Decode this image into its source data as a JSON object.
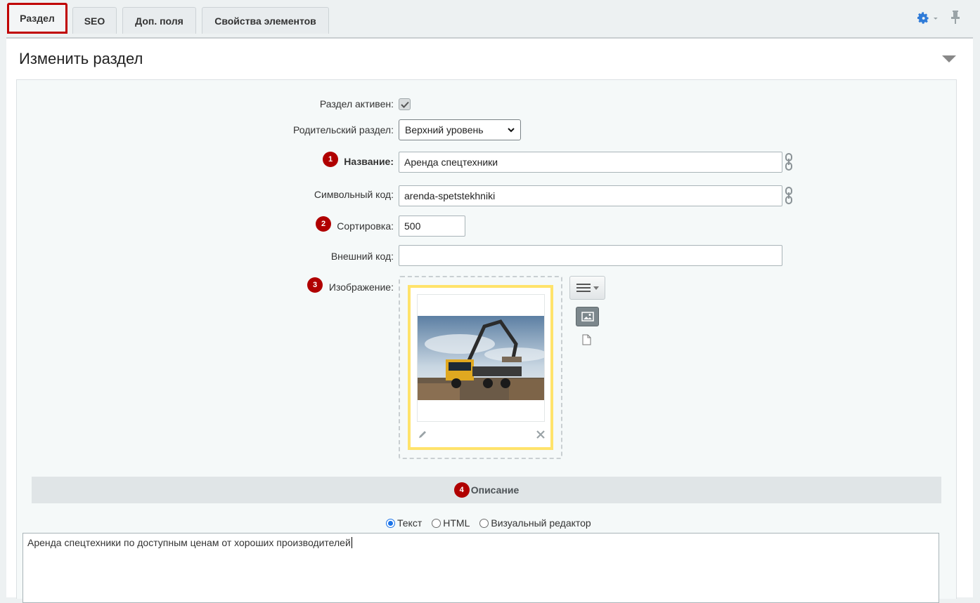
{
  "tabs": [
    {
      "label": "Раздел",
      "active": true
    },
    {
      "label": "SEO",
      "active": false
    },
    {
      "label": "Доп. поля",
      "active": false
    },
    {
      "label": "Свойства элементов",
      "active": false
    }
  ],
  "panel": {
    "title": "Изменить раздел"
  },
  "form": {
    "active": {
      "label": "Раздел активен:",
      "checked": true
    },
    "parent": {
      "label": "Родительский раздел:",
      "value": "Верхний уровень"
    },
    "name": {
      "badge": "1",
      "label": "Название:",
      "value": "Аренда спецтехники"
    },
    "code": {
      "label": "Символьный код:",
      "value": "arenda-spetstekhniki"
    },
    "sort": {
      "badge": "2",
      "label": "Сортировка:",
      "value": "500"
    },
    "external": {
      "label": "Внешний код:",
      "value": ""
    },
    "image": {
      "badge": "3",
      "label": "Изображение:"
    }
  },
  "description": {
    "badge": "4",
    "title": "Описание",
    "modes": [
      "Текст",
      "HTML",
      "Визуальный редактор"
    ],
    "selected_mode": "Текст",
    "text": "Аренда спецтехники по доступным ценам от хороших производителей"
  },
  "icons": {
    "settings": "gear-icon",
    "pin": "pin-icon",
    "collapse": "collapse-triangle-icon",
    "transliterate": "chain-link-icon",
    "edit": "pencil-icon",
    "delete": "close-icon",
    "menu": "menu-icon",
    "image_mode": "image-icon",
    "file_mode": "file-icon"
  },
  "colors": {
    "accent": "#c00000",
    "badge": "#b00000",
    "highlight": "#ffe36b",
    "link": "#1a73e8"
  }
}
